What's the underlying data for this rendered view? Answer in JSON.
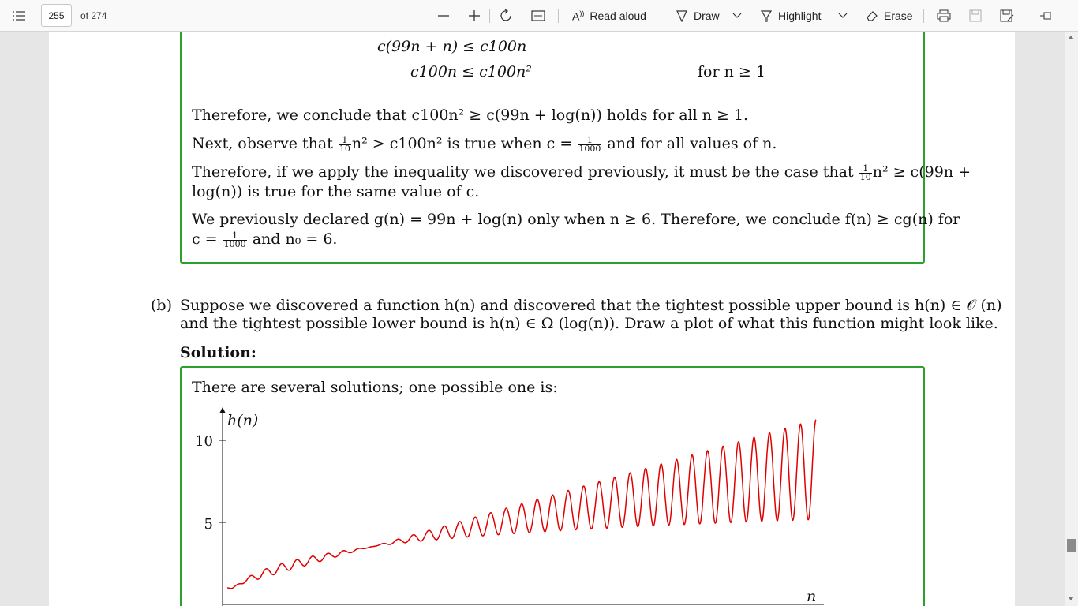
{
  "toolbar": {
    "page_current": "255",
    "page_total": "of 274",
    "read_aloud": "Read aloud",
    "draw": "Draw",
    "highlight": "Highlight",
    "erase": "Erase"
  },
  "doc": {
    "line1": "c(99n + n) ≤ c100n",
    "line2": "c100n ≤ c100n²",
    "line2_cond": "for n ≥ 1",
    "p1": "Therefore, we conclude that c100n² ≥ c(99n + log(n)) holds for all n ≥ 1.",
    "p2_a": "Next, observe that",
    "p2_b": "n² > c100n² is true when c =",
    "p2_c": "and for all values of n.",
    "frac_one": "1",
    "frac_ten": "10",
    "frac_thousand": "1000",
    "p3_a": "Therefore, if we apply the inequality we discovered previously, it must be the case that",
    "p3_b": "n² ≥ c(99n +",
    "p3_c": "log(n)) is true for the same value of c.",
    "p4_a": "We previously declared g(n) = 99n + log(n) only when n ≥ 6. Therefore, we conclude f(n) ≥ cg(n) for",
    "p4_b": "c =",
    "p4_c": "and n₀ = 6.",
    "part_label": "(b)",
    "q_line1": "Suppose we discovered a function h(n) and discovered that the tightest possible upper bound is h(n) ∈ 𝒪 (n)",
    "q_line2": "and the tightest possible lower bound is h(n) ∈ Ω (log(n)). Draw a plot of what this function might look like.",
    "solution_label": "Solution:",
    "solution_intro": "There are several solutions; one possible one is:"
  },
  "chart_data": {
    "type": "line",
    "ylabel": "h(n)",
    "xlabel": "n",
    "yticks": [
      "10",
      "5"
    ],
    "ylim": [
      0,
      11.5
    ],
    "xlim": [
      0,
      38
    ],
    "series": [
      {
        "color": "#e00000",
        "oscillations": 38,
        "lower_trend": "log-like",
        "upper_trend": "linear"
      }
    ],
    "colors": {
      "line": "#e00000",
      "box": "#2ca02c"
    }
  }
}
